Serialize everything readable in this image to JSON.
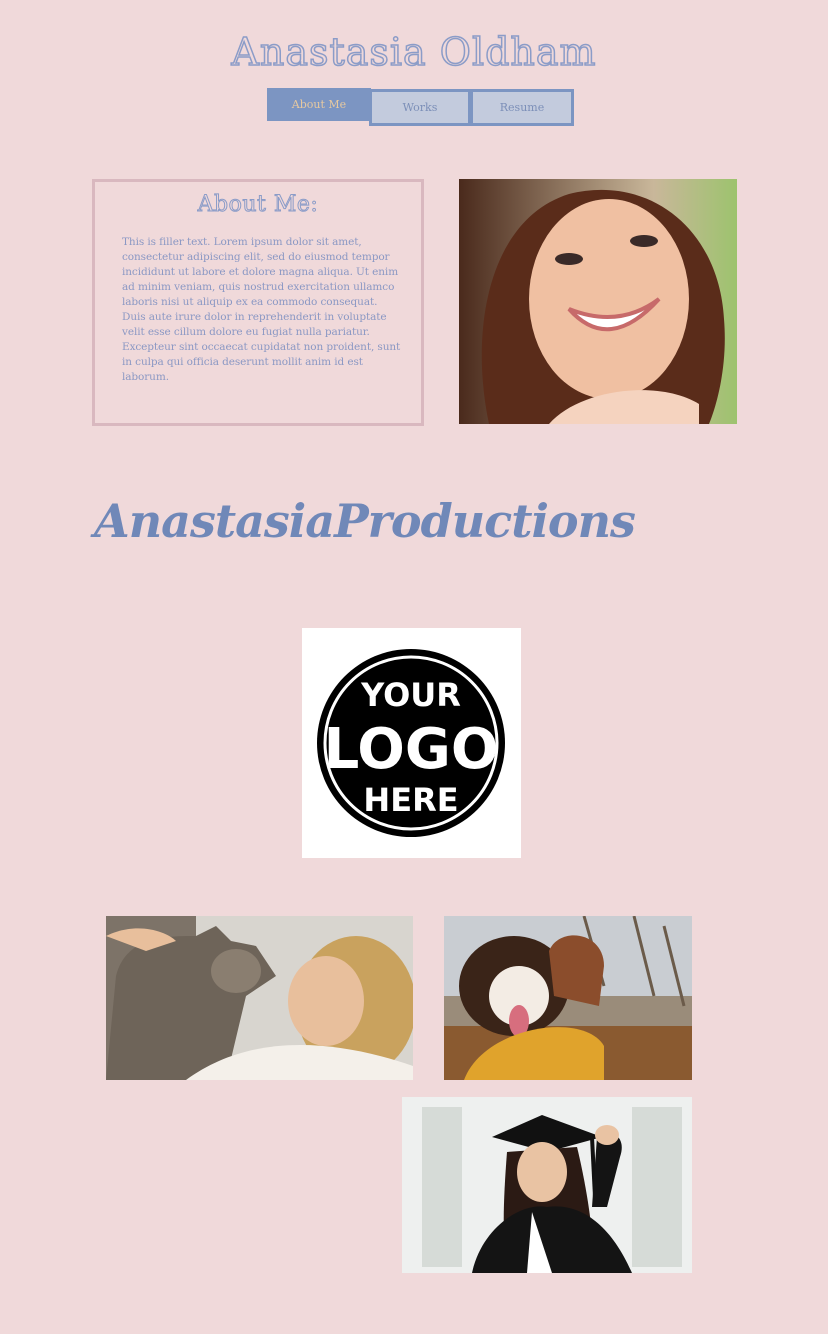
{
  "header": {
    "title": "Anastasia Oldham"
  },
  "nav": {
    "items": [
      {
        "label": "About Me"
      },
      {
        "label": "Works"
      },
      {
        "label": "Resume"
      }
    ]
  },
  "about": {
    "heading": "About Me:",
    "body": "This is filler text. Lorem ipsum dolor sit amet, consectetur adipiscing elit, sed do eiusmod tempor incididunt ut labore et dolore magna aliqua. Ut enim ad minim veniam, quis nostrud exercitation ullamco laboris nisi ut aliquip ex ea commodo consequat. Duis aute irure dolor in reprehenderit in voluptate velit esse cillum dolore eu fugiat nulla pariatur. Excepteur sint occaecat cupidatat non proident, sunt in culpa qui officia deserunt mollit anim id est laborum."
  },
  "productions": {
    "heading": "AnastasiaProductions",
    "logo": {
      "line1": "YOUR",
      "line2": "LOGO",
      "line3": "HERE"
    }
  },
  "colors": {
    "background": "#f0d9da",
    "accent": "#7c95c2",
    "nav_inactive": "#c3cbdd",
    "active_text": "#e7c9a0",
    "panel_border": "#d9b8bf"
  },
  "icons": {
    "portrait": "woman-portrait-photo",
    "cat": "woman-with-cat-photo",
    "dog": "woman-hugging-dog-photo",
    "graduate": "graduate-photo"
  }
}
